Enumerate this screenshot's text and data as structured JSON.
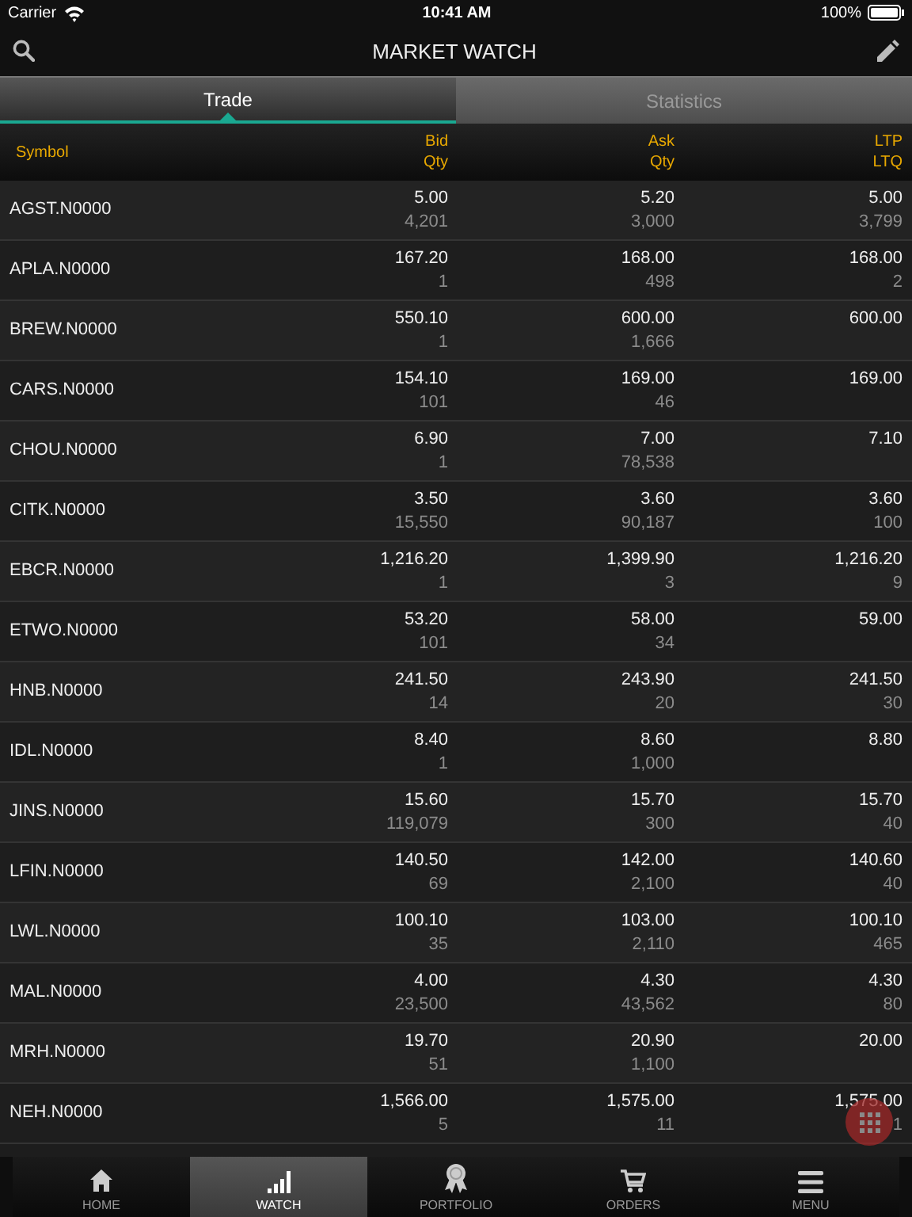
{
  "status_bar": {
    "carrier": "Carrier",
    "time": "10:41 AM",
    "battery": "100%"
  },
  "header": {
    "title": "MARKET WATCH"
  },
  "tabs": [
    {
      "label": "Trade",
      "selected": true
    },
    {
      "label": "Statistics",
      "selected": false
    }
  ],
  "table": {
    "columns": [
      {
        "top": "Symbol"
      },
      {
        "top": "Bid",
        "bottom": "Qty"
      },
      {
        "top": "Ask",
        "bottom": "Qty"
      },
      {
        "top": "LTP",
        "bottom": "LTQ"
      }
    ],
    "rows": [
      {
        "symbol": "AGST.N0000",
        "bid": "5.00",
        "bid_qty": "4,201",
        "ask": "5.20",
        "ask_qty": "3,000",
        "ltp": "5.00",
        "ltq": "3,799"
      },
      {
        "symbol": "APLA.N0000",
        "bid": "167.20",
        "bid_qty": "1",
        "ask": "168.00",
        "ask_qty": "498",
        "ltp": "168.00",
        "ltq": "2"
      },
      {
        "symbol": "BREW.N0000",
        "bid": "550.10",
        "bid_qty": "1",
        "ask": "600.00",
        "ask_qty": "1,666",
        "ltp": "600.00"
      },
      {
        "symbol": "CARS.N0000",
        "bid": "154.10",
        "bid_qty": "101",
        "ask": "169.00",
        "ask_qty": "46",
        "ltp": "169.00"
      },
      {
        "symbol": "CHOU.N0000",
        "bid": "6.90",
        "bid_qty": "1",
        "ask": "7.00",
        "ask_qty": "78,538",
        "ltp": "7.10"
      },
      {
        "symbol": "CITK.N0000",
        "bid": "3.50",
        "bid_qty": "15,550",
        "ask": "3.60",
        "ask_qty": "90,187",
        "ltp": "3.60",
        "ltq": "100"
      },
      {
        "symbol": "EBCR.N0000",
        "bid": "1,216.20",
        "bid_qty": "1",
        "ask": "1,399.90",
        "ask_qty": "3",
        "ltp": "1,216.20",
        "ltq": "9"
      },
      {
        "symbol": "ETWO.N0000",
        "bid": "53.20",
        "bid_qty": "101",
        "ask": "58.00",
        "ask_qty": "34",
        "ltp": "59.00"
      },
      {
        "symbol": "HNB.N0000",
        "bid": "241.50",
        "bid_qty": "14",
        "ask": "243.90",
        "ask_qty": "20",
        "ltp": "241.50",
        "ltq": "30"
      },
      {
        "symbol": "IDL.N0000",
        "bid": "8.40",
        "bid_qty": "1",
        "ask": "8.60",
        "ask_qty": "1,000",
        "ltp": "8.80"
      },
      {
        "symbol": "JINS.N0000",
        "bid": "15.60",
        "bid_qty": "119,079",
        "ask": "15.70",
        "ask_qty": "300",
        "ltp": "15.70",
        "ltq": "40"
      },
      {
        "symbol": "LFIN.N0000",
        "bid": "140.50",
        "bid_qty": "69",
        "ask": "142.00",
        "ask_qty": "2,100",
        "ltp": "140.60",
        "ltq": "40"
      },
      {
        "symbol": "LWL.N0000",
        "bid": "100.10",
        "bid_qty": "35",
        "ask": "103.00",
        "ask_qty": "2,110",
        "ltp": "100.10",
        "ltq": "465"
      },
      {
        "symbol": "MAL.N0000",
        "bid": "4.00",
        "bid_qty": "23,500",
        "ask": "4.30",
        "ask_qty": "43,562",
        "ltp": "4.30",
        "ltq": "80"
      },
      {
        "symbol": "MRH.N0000",
        "bid": "19.70",
        "bid_qty": "51",
        "ask": "20.90",
        "ask_qty": "1,100",
        "ltp": "20.00"
      },
      {
        "symbol": "NEH.N0000",
        "bid": "1,566.00",
        "bid_qty": "5",
        "ask": "1,575.00",
        "ask_qty": "11",
        "ltp": "1,575.00",
        "ltq": "1"
      }
    ]
  },
  "nav": [
    {
      "label": "HOME",
      "kind": "home",
      "selected": false
    },
    {
      "label": "WATCH",
      "kind": "watch",
      "selected": true
    },
    {
      "label": "PORTFOLIO",
      "kind": "portfolio",
      "selected": false
    },
    {
      "label": "ORDERS",
      "kind": "orders",
      "selected": false
    },
    {
      "label": "MENU",
      "kind": "menu",
      "selected": false
    }
  ]
}
